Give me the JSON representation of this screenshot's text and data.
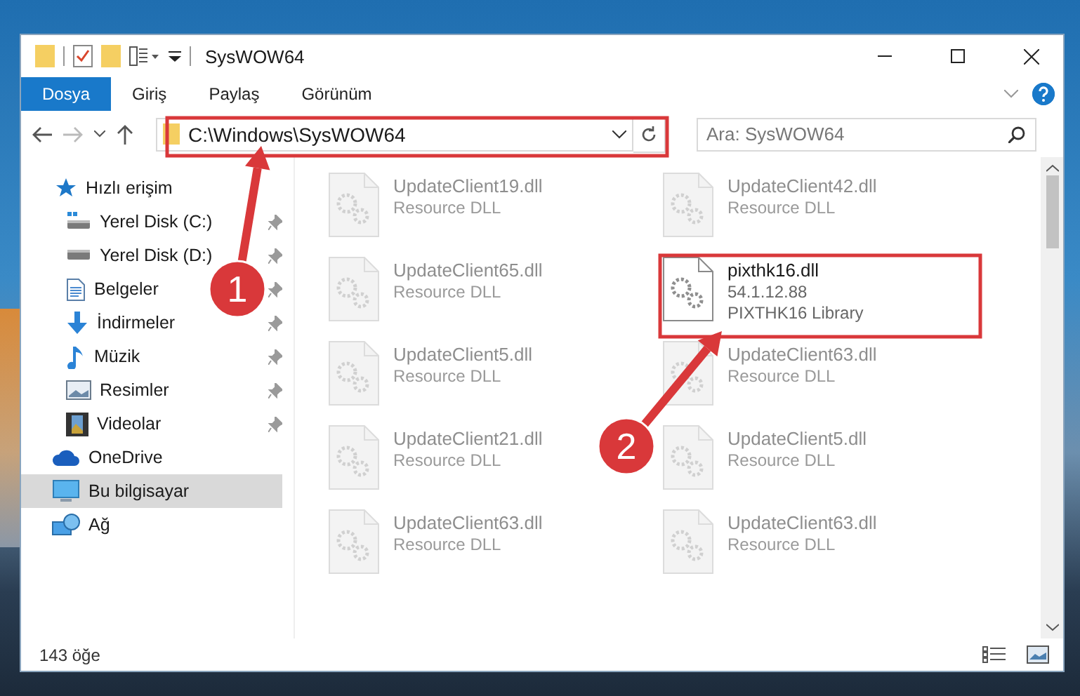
{
  "window": {
    "title": "SysWOW64"
  },
  "ribbon_tabs": [
    {
      "label": "Dosya",
      "selected": true
    },
    {
      "label": "Giriş",
      "selected": false
    },
    {
      "label": "Paylaş",
      "selected": false
    },
    {
      "label": "Görünüm",
      "selected": false
    }
  ],
  "address_bar": {
    "value": "C:\\Windows\\SysWOW64"
  },
  "search": {
    "placeholder": "Ara: SysWOW64"
  },
  "sidebar": {
    "items": [
      {
        "label": "Hızlı erişim",
        "kind": "star",
        "selected": false,
        "children": [
          {
            "label": "Yerel Disk (C:)",
            "kind": "drive-win",
            "pinned": true,
            "selected": false
          },
          {
            "label": "Yerel Disk (D:)",
            "kind": "drive",
            "pinned": true,
            "selected": false
          },
          {
            "label": "Belgeler",
            "kind": "documents",
            "pinned": true,
            "selected": false
          },
          {
            "label": "İndirmeler",
            "kind": "downloads",
            "pinned": true,
            "selected": false
          },
          {
            "label": "Müzik",
            "kind": "music",
            "pinned": true,
            "selected": false
          },
          {
            "label": "Resimler",
            "kind": "pictures",
            "pinned": true,
            "selected": false
          },
          {
            "label": "Videolar",
            "kind": "videos",
            "pinned": true,
            "selected": false
          }
        ]
      },
      {
        "label": "OneDrive",
        "kind": "cloud",
        "selected": false
      },
      {
        "label": "Bu bilgisayar",
        "kind": "computer",
        "selected": true
      },
      {
        "label": "Ağ",
        "kind": "network",
        "selected": false
      }
    ]
  },
  "files": [
    {
      "name": "UpdateClient19.dll",
      "lines": [
        "Resource DLL"
      ],
      "selected": false
    },
    {
      "name": "UpdateClient42.dll",
      "lines": [
        "Resource DLL"
      ],
      "selected": false
    },
    {
      "name": "UpdateClient65.dll",
      "lines": [
        "Resource DLL"
      ],
      "selected": false
    },
    {
      "name": "pixthk16.dll",
      "lines": [
        "54.1.12.88",
        "PIXTHK16 Library"
      ],
      "selected": true
    },
    {
      "name": "UpdateClient5.dll",
      "lines": [
        "Resource DLL"
      ],
      "selected": false
    },
    {
      "name": "UpdateClient63.dll",
      "lines": [
        "Resource DLL"
      ],
      "selected": false
    },
    {
      "name": "UpdateClient21.dll",
      "lines": [
        "Resource DLL"
      ],
      "selected": false
    },
    {
      "name": "UpdateClient5.dll",
      "lines": [
        "Resource DLL"
      ],
      "selected": false
    },
    {
      "name": "UpdateClient63.dll",
      "lines": [
        "Resource DLL"
      ],
      "selected": false
    },
    {
      "name": "UpdateClient63.dll",
      "lines": [
        "Resource DLL"
      ],
      "selected": false
    }
  ],
  "status_bar": {
    "item_count": "143 öğe"
  },
  "annotations": [
    {
      "label": "1"
    },
    {
      "label": "2"
    }
  ]
}
